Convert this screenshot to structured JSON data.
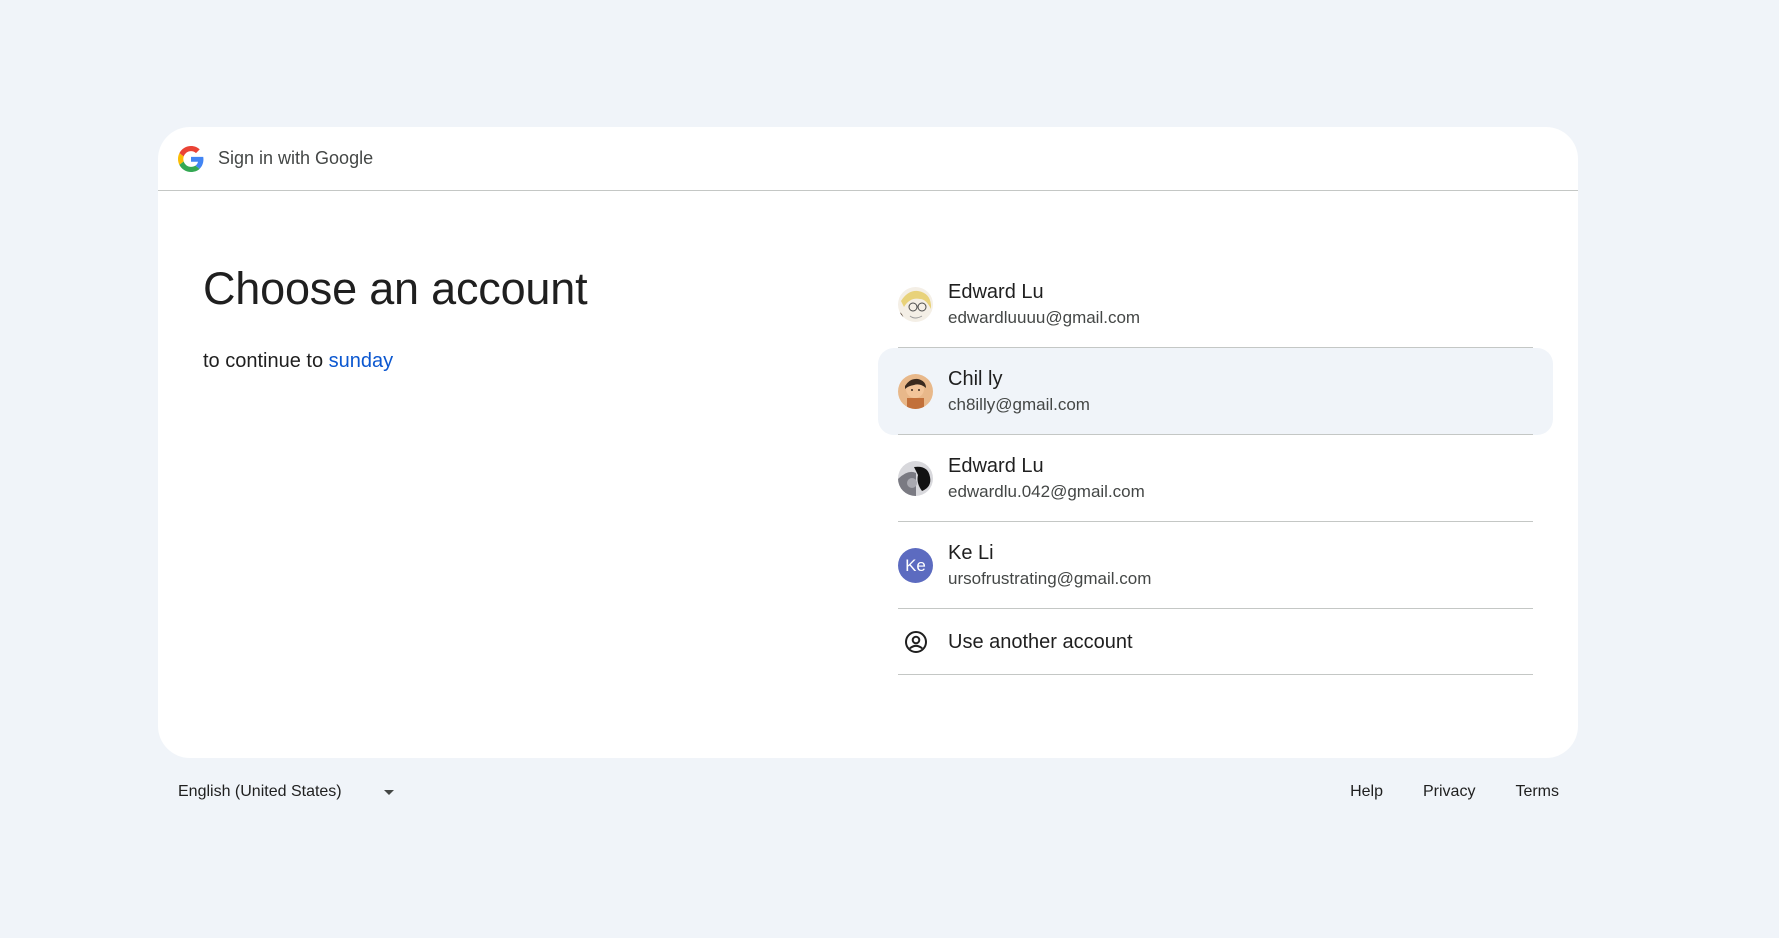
{
  "header": {
    "title": "Sign in with Google",
    "logo_icon": "google-g-icon"
  },
  "main": {
    "title": "Choose an account",
    "subtitle_prefix": "to continue to",
    "app_name": "sunday"
  },
  "accounts": [
    {
      "name": "Edward Lu",
      "email": "edwardluuuu@gmail.com",
      "avatar": "anime-character-avatar"
    },
    {
      "name": "Chil ly",
      "email": "ch8illy@gmail.com",
      "avatar": "orange-character-avatar"
    },
    {
      "name": "Edward Lu",
      "email": "edwardlu.042@gmail.com",
      "avatar": "dark-photo-avatar"
    },
    {
      "name": "Ke Li",
      "email": "ursofrustrating@gmail.com",
      "avatar_initials": "Ke"
    }
  ],
  "use_another": {
    "label": "Use another account",
    "icon": "person-circle-icon"
  },
  "footer": {
    "language": "English (United States)",
    "help": "Help",
    "privacy": "Privacy",
    "terms": "Terms"
  },
  "colors": {
    "page_bg": "#f0f4f9",
    "card_bg": "#ffffff",
    "link": "#0b57d0",
    "highlight": "#f0f4f9",
    "initials_avatar": "#5c6bc0"
  }
}
